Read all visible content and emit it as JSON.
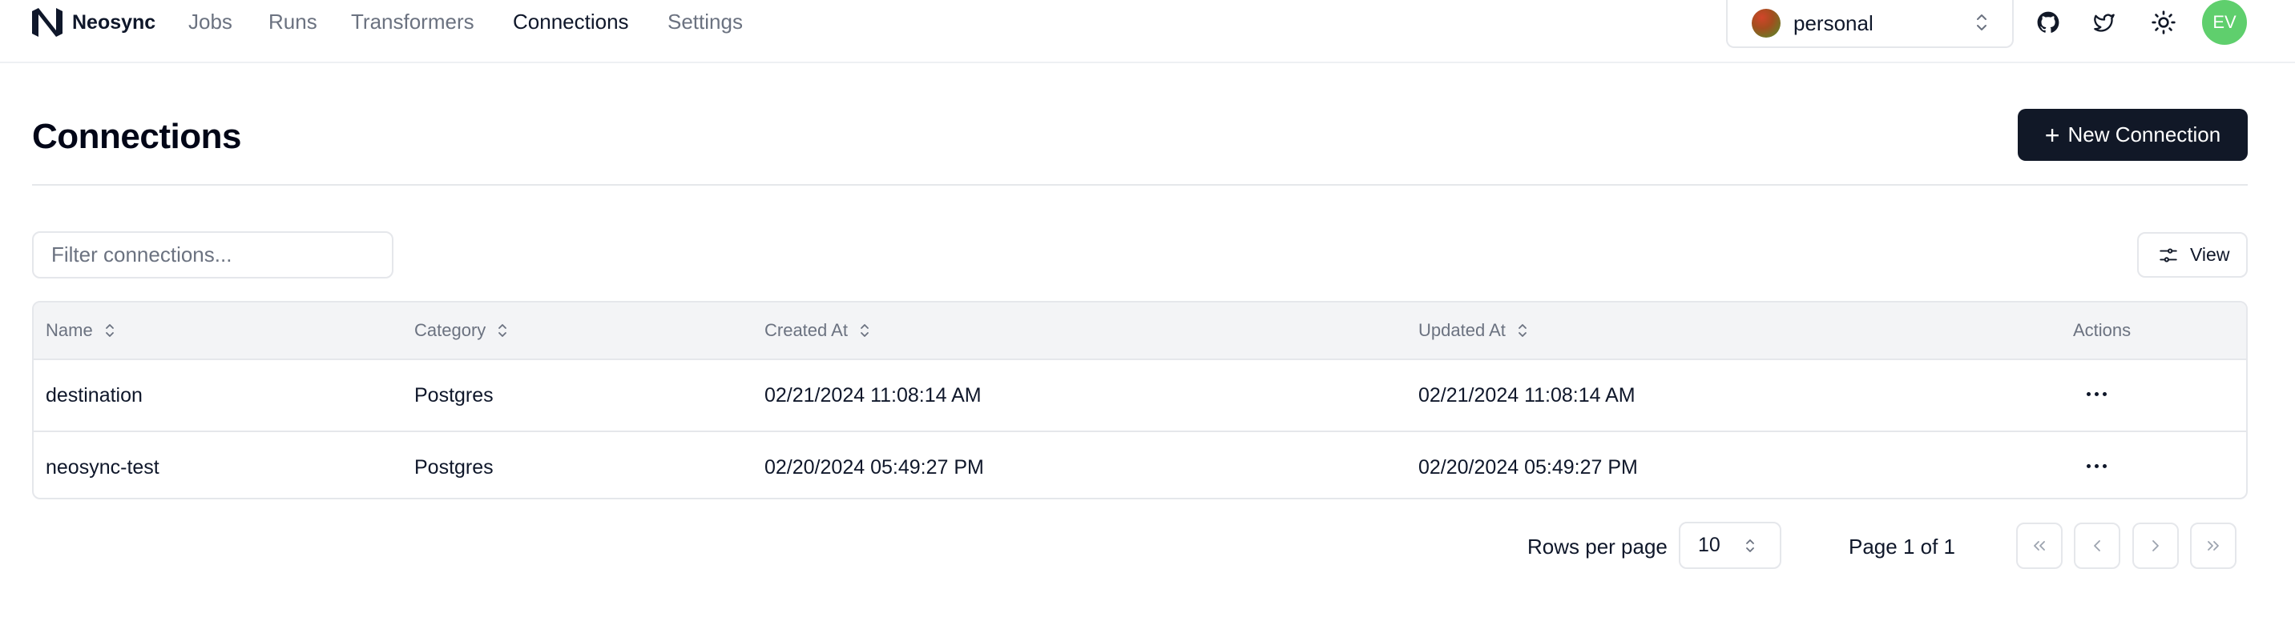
{
  "nav": {
    "brand": "Neosync",
    "links": [
      "Jobs",
      "Runs",
      "Transformers",
      "Connections",
      "Settings"
    ],
    "active": "Connections",
    "account": "personal",
    "user_initials": "EV"
  },
  "header": {
    "title": "Connections",
    "new_button": "New Connection",
    "new_button_icon": "plus-icon"
  },
  "filter": {
    "placeholder": "Filter connections..."
  },
  "view_button": {
    "label": "View",
    "icon": "sliders-icon"
  },
  "table": {
    "columns": [
      "Name",
      "Category",
      "Created At",
      "Updated At",
      "Actions"
    ],
    "rows": [
      {
        "name": "destination",
        "category": "Postgres",
        "created_at": "02/21/2024 11:08:14 AM",
        "updated_at": "02/21/2024 11:08:14 AM"
      },
      {
        "name": "neosync-test",
        "category": "Postgres",
        "created_at": "02/20/2024 05:49:27 PM",
        "updated_at": "02/20/2024 05:49:27 PM"
      }
    ]
  },
  "pagination": {
    "rows_per_page_label": "Rows per page",
    "rows_per_page": "10",
    "page_info": "Page 1 of 1"
  },
  "colors": {
    "primary_button": "#111827",
    "avatar": "#5fcf6d",
    "header_bg": "#f3f4f6",
    "border": "#e5e7eb",
    "muted_text": "#6b7280"
  }
}
